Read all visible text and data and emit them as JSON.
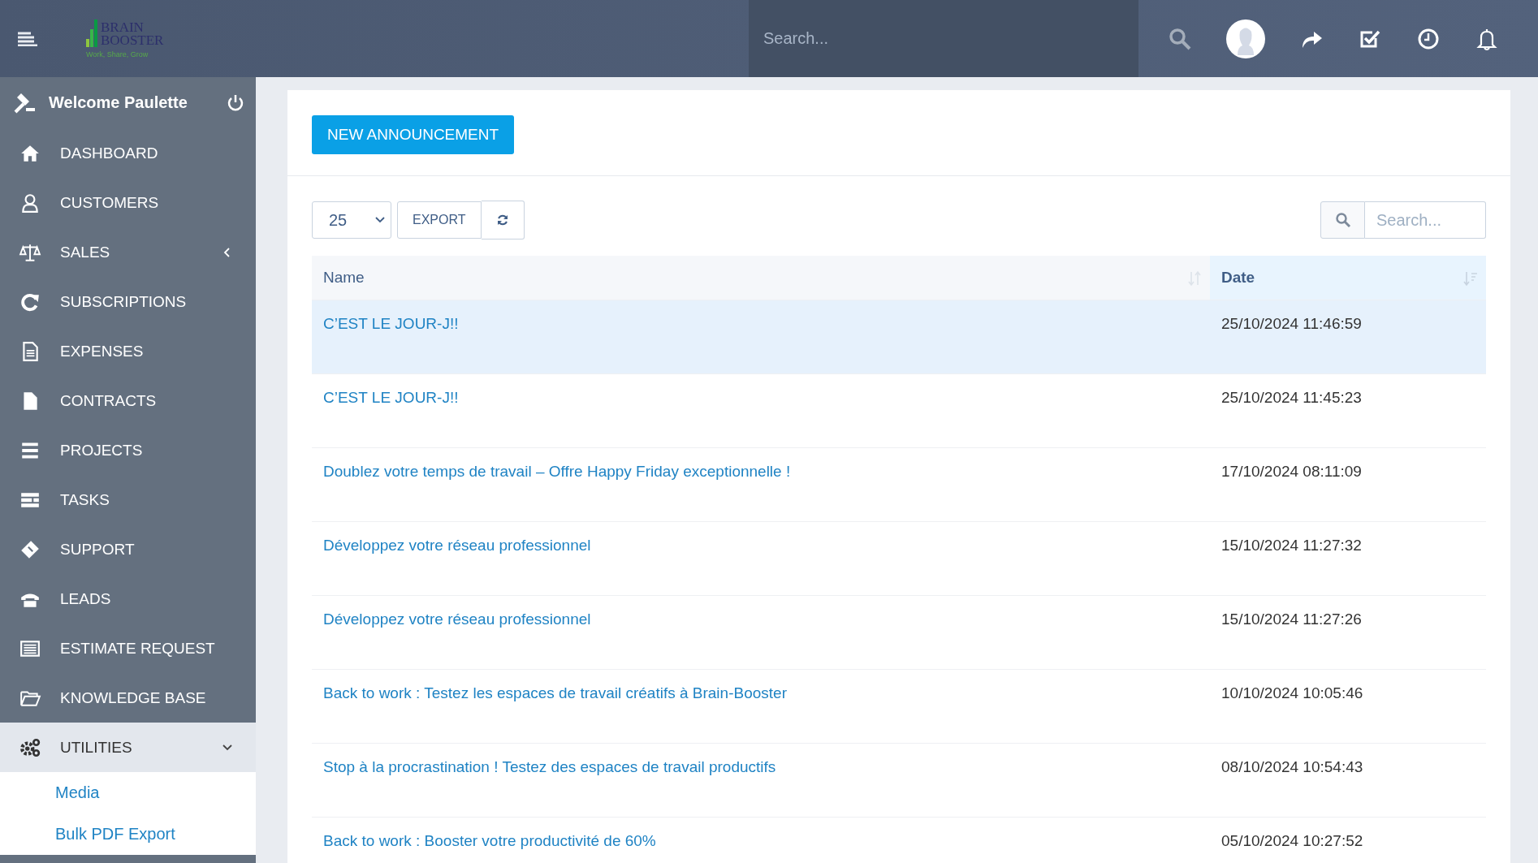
{
  "logo": {
    "line1": "BRAIN",
    "line2": "BOOSTER",
    "tagline": "Work, Share, Grow"
  },
  "search": {
    "placeholder": "Search..."
  },
  "sidebar": {
    "welcome": "Welcome Paulette",
    "items": [
      {
        "label": "DASHBOARD"
      },
      {
        "label": "CUSTOMERS"
      },
      {
        "label": "SALES",
        "expanded": false
      },
      {
        "label": "SUBSCRIPTIONS"
      },
      {
        "label": "EXPENSES"
      },
      {
        "label": "CONTRACTS"
      },
      {
        "label": "PROJECTS"
      },
      {
        "label": "TASKS"
      },
      {
        "label": "SUPPORT"
      },
      {
        "label": "LEADS"
      },
      {
        "label": "ESTIMATE REQUEST"
      },
      {
        "label": "KNOWLEDGE BASE"
      },
      {
        "label": "UTILITIES",
        "expanded": true,
        "children": [
          {
            "label": "Media"
          },
          {
            "label": "Bulk PDF Export"
          }
        ]
      }
    ]
  },
  "new_button": "NEW ANNOUNCEMENT",
  "table_tools": {
    "page_size": "25",
    "export": "EXPORT",
    "search_placeholder": "Search..."
  },
  "table": {
    "columns": [
      {
        "label": "Name",
        "sorted": false
      },
      {
        "label": "Date",
        "sorted": true
      }
    ],
    "rows": [
      {
        "name": "C’EST LE JOUR-J!!",
        "date": "25/10/2024 11:46:59",
        "highlighted": true
      },
      {
        "name": "C’EST LE JOUR-J!!",
        "date": "25/10/2024 11:45:23",
        "highlighted": false
      },
      {
        "name": "Doublez votre temps de travail – Offre Happy Friday exceptionnelle !",
        "date": "17/10/2024 08:11:09",
        "highlighted": false
      },
      {
        "name": "Développez votre réseau professionnel",
        "date": "15/10/2024 11:27:32",
        "highlighted": false
      },
      {
        "name": "Développez votre réseau professionnel",
        "date": "15/10/2024 11:27:26",
        "highlighted": false
      },
      {
        "name": "Back to work : Testez les espaces de travail créatifs à Brain-Booster",
        "date": "10/10/2024 10:05:46",
        "highlighted": false
      },
      {
        "name": "Stop à la procrastination ! Testez des espaces de travail productifs",
        "date": "08/10/2024 10:54:43",
        "highlighted": false
      },
      {
        "name": "Back to work : Booster votre productivité de 60%",
        "date": "05/10/2024 10:27:52",
        "highlighted": false
      }
    ]
  }
}
